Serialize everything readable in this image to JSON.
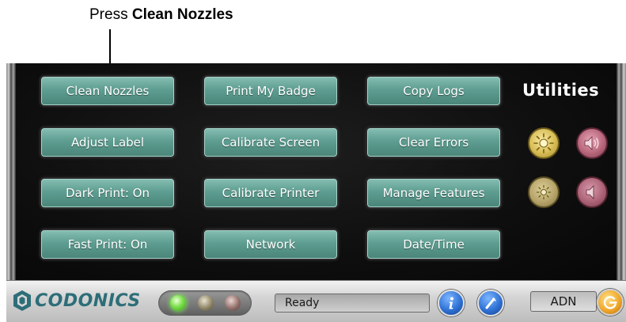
{
  "callout": {
    "prefix": "Press ",
    "emphasis": "Clean Nozzles"
  },
  "utilities": {
    "title": "Utilities",
    "buttons": [
      {
        "label": "Clean Nozzles"
      },
      {
        "label": "Print My Badge"
      },
      {
        "label": "Copy Logs"
      },
      {
        "label": "Adjust Label"
      },
      {
        "label": "Calibrate Screen"
      },
      {
        "label": "Clear Errors"
      },
      {
        "label": "Dark Print: On"
      },
      {
        "label": "Calibrate Printer"
      },
      {
        "label": "Manage Features"
      },
      {
        "label": "Fast Print: On"
      },
      {
        "label": "Network"
      },
      {
        "label": "Date/Time"
      }
    ],
    "controls": [
      {
        "icon": "brightness-up-icon"
      },
      {
        "icon": "volume-up-icon"
      },
      {
        "icon": "brightness-down-icon"
      },
      {
        "icon": "volume-down-icon"
      }
    ]
  },
  "status_bar": {
    "logo": "CODONICS",
    "status_text": "Ready",
    "user": "ADN",
    "indicators": [
      {
        "name": "ready-led",
        "state": "on",
        "color": "#7be04a"
      },
      {
        "name": "warning-led",
        "state": "off",
        "color": "#8f8668"
      },
      {
        "name": "error-led",
        "state": "off",
        "color": "#92706b"
      }
    ],
    "icons": [
      "info-icon",
      "help-icon",
      "logout-icon"
    ]
  },
  "colors": {
    "button": "#5e9d91",
    "brand": "#2d6e78",
    "screen_bg": "#0c0c0c"
  }
}
